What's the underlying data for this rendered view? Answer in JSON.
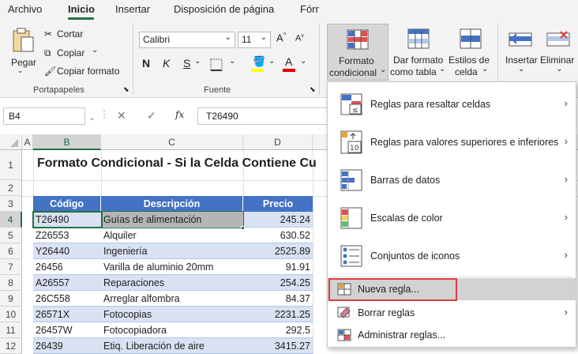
{
  "tabs": [
    "Archivo",
    "Inicio",
    "Insertar",
    "Disposición de página",
    "Fórr"
  ],
  "ribbon": {
    "pegar": "Pegar",
    "cortar": "Cortar",
    "copiar": "Copiar",
    "copiar_formato": "Copiar formato",
    "portapapeles": "Portapapeles",
    "font_name": "Calibri",
    "font_size": "11",
    "fuente": "Fuente",
    "bold": "N",
    "italic": "K",
    "underline": "S",
    "formato_condicional_1": "Formato",
    "formato_condicional_2": "condicional",
    "dar_formato_1": "Dar formato",
    "dar_formato_2": "como tabla",
    "estilos_1": "Estilos de",
    "estilos_2": "celda",
    "insertar": "Insertar",
    "eliminar": "Eliminar"
  },
  "formula_bar": {
    "cell_ref": "B4",
    "fx": "fx",
    "content": "T26490"
  },
  "grid": {
    "columns": [
      "A",
      "B",
      "C",
      "D"
    ],
    "rows": [
      "1",
      "2",
      "3",
      "4",
      "5",
      "6",
      "7",
      "8",
      "9",
      "10",
      "11",
      "12"
    ],
    "title": "Formato Condicional - Si la Celda Contiene Cu",
    "headers": [
      "Código",
      "Descripción",
      "Precio"
    ],
    "data": [
      [
        "T26490",
        "Guías de alimentación",
        "245.24"
      ],
      [
        "Z26553",
        "Alquiler",
        "630.52"
      ],
      [
        "Y26440",
        "Ingeniería",
        "2525.89"
      ],
      [
        "26456",
        "Varilla de aluminio 20mm",
        "91.91"
      ],
      [
        "A26557",
        "Reparaciones",
        "254.25"
      ],
      [
        "26C558",
        "Arreglar alfombra",
        "84.37"
      ],
      [
        "26571X",
        "Fotocopias",
        "2231.25"
      ],
      [
        "26457W",
        "Fotocopiadora",
        "292.5"
      ],
      [
        "26439",
        "Etiq. Liberación de aire",
        "3415.27"
      ]
    ]
  },
  "menu": {
    "items": [
      "Reglas para resaltar celdas",
      "Reglas para valores superiores e inferiores",
      "Barras de datos",
      "Escalas de color",
      "Conjuntos de iconos",
      "Nueva regla...",
      "Borrar reglas",
      "Administrar reglas..."
    ]
  },
  "colors": {
    "accent_green": "#217346",
    "header_blue": "#4472c4",
    "band_light": "#d9e1f2",
    "highlight_red": "#e03c3c"
  }
}
